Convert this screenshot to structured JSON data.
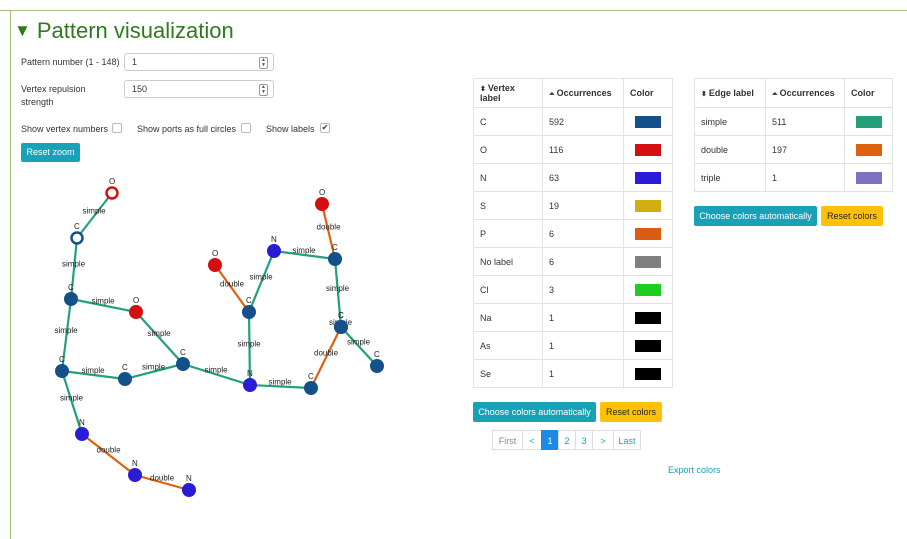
{
  "title": "Pattern visualization",
  "controls": {
    "pattern_label": "Pattern number (1 - 148)",
    "pattern_value": "1",
    "repulsion_label_line1": "Vertex repulsion",
    "repulsion_label_line2": "strength",
    "repulsion_value": "150",
    "show_vertex_numbers": "Show vertex numbers",
    "show_ports": "Show ports as full circles",
    "show_labels": "Show labels",
    "show_vertex_numbers_checked": false,
    "show_ports_checked": false,
    "show_labels_checked": true,
    "reset_zoom": "Reset zoom"
  },
  "vertex_table": {
    "headers": [
      "Vertex label",
      "Occurrences",
      "Color"
    ],
    "rows": [
      {
        "label": "C",
        "count": "592",
        "color": "#14508a"
      },
      {
        "label": "O",
        "count": "116",
        "color": "#d50f0f"
      },
      {
        "label": "N",
        "count": "63",
        "color": "#2a1cd6"
      },
      {
        "label": "S",
        "count": "19",
        "color": "#cfae12"
      },
      {
        "label": "P",
        "count": "6",
        "color": "#dc5a11"
      },
      {
        "label": "No label",
        "count": "6",
        "color": "#808080"
      },
      {
        "label": "Cl",
        "count": "3",
        "color": "#1fcc22"
      },
      {
        "label": "Na",
        "count": "1",
        "color": "#000000"
      },
      {
        "label": "As",
        "count": "1",
        "color": "#000000"
      },
      {
        "label": "Se",
        "count": "1",
        "color": "#000000"
      }
    ],
    "choose_auto": "Choose colors automatically",
    "reset": "Reset colors"
  },
  "edge_table": {
    "headers": [
      "Edge label",
      "Occurrences",
      "Color"
    ],
    "rows": [
      {
        "label": "simple",
        "count": "511",
        "color": "#22a07a"
      },
      {
        "label": "double",
        "count": "197",
        "color": "#e06010"
      },
      {
        "label": "triple",
        "count": "1",
        "color": "#7e70c2"
      }
    ],
    "choose_auto": "Choose colors automatically",
    "reset": "Reset colors"
  },
  "pager": {
    "first": "First",
    "prev": "<",
    "pages": [
      "1",
      "2",
      "3"
    ],
    "active": "1",
    "next": ">",
    "last": "Last"
  },
  "export": "Export colors",
  "graph": {
    "colors": {
      "C": "#14508a",
      "O": "#d50f0f",
      "N": "#2a1cd6",
      "simple": "#22a07a",
      "double": "#e06010"
    },
    "nodes": [
      {
        "id": "o1",
        "label": "O",
        "hollow": true
      },
      {
        "id": "c1",
        "label": "C",
        "hollow": true
      },
      {
        "id": "c2",
        "label": "C"
      },
      {
        "id": "o2",
        "label": "O"
      },
      {
        "id": "c3",
        "label": "C"
      },
      {
        "id": "c4",
        "label": "C"
      },
      {
        "id": "c5",
        "label": "C"
      },
      {
        "id": "n1",
        "label": "N"
      },
      {
        "id": "n2",
        "label": "N"
      },
      {
        "id": "n3",
        "label": "N"
      },
      {
        "id": "o3",
        "label": "O"
      },
      {
        "id": "c6",
        "label": "C"
      },
      {
        "id": "n4",
        "label": "N"
      },
      {
        "id": "n5",
        "label": "N"
      },
      {
        "id": "o4",
        "label": "O"
      },
      {
        "id": "c7",
        "label": "C"
      },
      {
        "id": "c8",
        "label": "C"
      },
      {
        "id": "c9",
        "label": "C"
      },
      {
        "id": "c10",
        "label": "C"
      },
      {
        "id": "c11",
        "label": "C"
      }
    ],
    "edges": [
      {
        "from": "o1",
        "to": "c1",
        "label": "simple"
      },
      {
        "from": "c1",
        "to": "c2",
        "label": "simple"
      },
      {
        "from": "c2",
        "to": "o2",
        "label": "simple"
      },
      {
        "from": "c2",
        "to": "c3",
        "label": "simple"
      },
      {
        "from": "o2",
        "to": "c5",
        "label": "simple"
      },
      {
        "from": "c3",
        "to": "c4",
        "label": "simple"
      },
      {
        "from": "c4",
        "to": "c5",
        "label": "simple"
      },
      {
        "from": "c3",
        "to": "n1",
        "label": "simple"
      },
      {
        "from": "n1",
        "to": "n2",
        "label": "double"
      },
      {
        "from": "n2",
        "to": "n3",
        "label": "double"
      },
      {
        "from": "c5",
        "to": "n5",
        "label": "simple"
      },
      {
        "from": "o3",
        "to": "c6",
        "label": "double"
      },
      {
        "from": "n4",
        "to": "c6",
        "label": "simple"
      },
      {
        "from": "c6",
        "to": "n5",
        "label": "simple"
      },
      {
        "from": "n4",
        "to": "c7",
        "label": "simple"
      },
      {
        "from": "o4",
        "to": "c7",
        "label": "double"
      },
      {
        "from": "c7",
        "to": "c8",
        "label": "simple"
      },
      {
        "from": "c8",
        "to": "c9",
        "label": "simple"
      },
      {
        "from": "c9",
        "to": "c10",
        "label": "double"
      },
      {
        "from": "n5",
        "to": "c10",
        "label": "simple"
      },
      {
        "from": "c8",
        "to": "c11",
        "label": "simple"
      }
    ]
  }
}
